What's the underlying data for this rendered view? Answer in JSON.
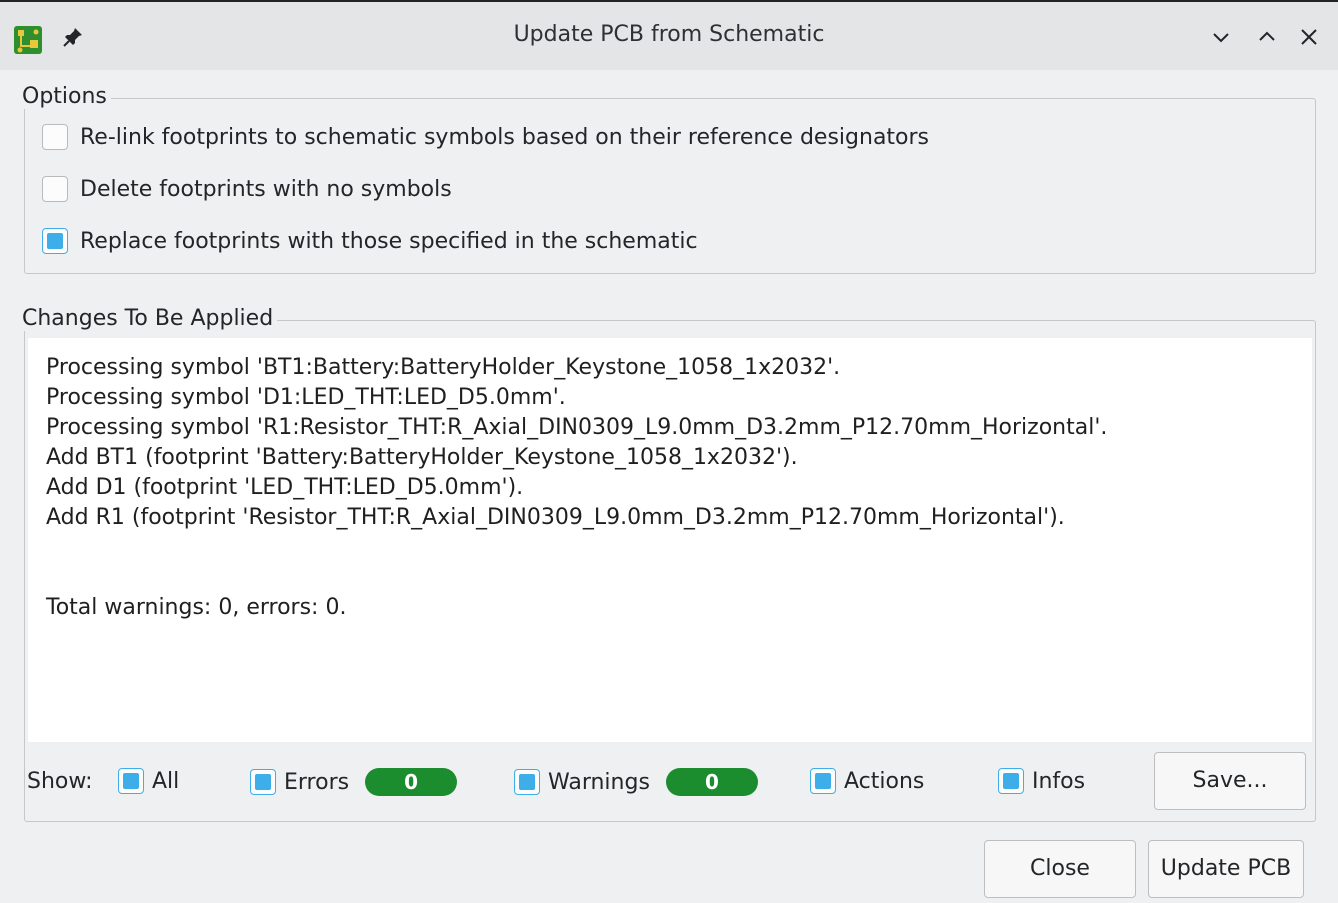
{
  "window": {
    "title": "Update PCB from Schematic",
    "app_icon": "kicad-pcbnew-icon",
    "controls": [
      "minimize-icon",
      "maximize-icon",
      "close-icon"
    ]
  },
  "options": {
    "legend": "Options",
    "items": [
      {
        "label": "Re-link footprints to schematic symbols based on their reference designators",
        "checked": false
      },
      {
        "label": "Delete footprints with no symbols",
        "checked": false
      },
      {
        "label": "Replace footprints with those specified in the schematic",
        "checked": true
      }
    ]
  },
  "changes": {
    "legend": "Changes To Be Applied",
    "log": [
      "Processing symbol 'BT1:Battery:BatteryHolder_Keystone_1058_1x2032'.",
      "Processing symbol 'D1:LED_THT:LED_D5.0mm'.",
      "Processing symbol 'R1:Resistor_THT:R_Axial_DIN0309_L9.0mm_D3.2mm_P12.70mm_Horizontal'.",
      "Add BT1 (footprint 'Battery:BatteryHolder_Keystone_1058_1x2032').",
      "Add D1 (footprint 'LED_THT:LED_D5.0mm').",
      "Add R1 (footprint 'Resistor_THT:R_Axial_DIN0309_L9.0mm_D3.2mm_P12.70mm_Horizontal')."
    ],
    "summary": "Total warnings: 0, errors: 0."
  },
  "filters": {
    "show_label": "Show:",
    "all": {
      "label": "All",
      "checked": true
    },
    "errors": {
      "label": "Errors",
      "checked": true,
      "count": "0"
    },
    "warnings": {
      "label": "Warnings",
      "checked": true,
      "count": "0"
    },
    "actions": {
      "label": "Actions",
      "checked": true
    },
    "infos": {
      "label": "Infos",
      "checked": true
    },
    "save_label": "Save..."
  },
  "buttons": {
    "close_label": "Close",
    "update_label": "Update PCB"
  },
  "colors": {
    "accent": "#3daee9",
    "badge_green": "#1b8d2f",
    "window_bg": "#eff0f1"
  }
}
